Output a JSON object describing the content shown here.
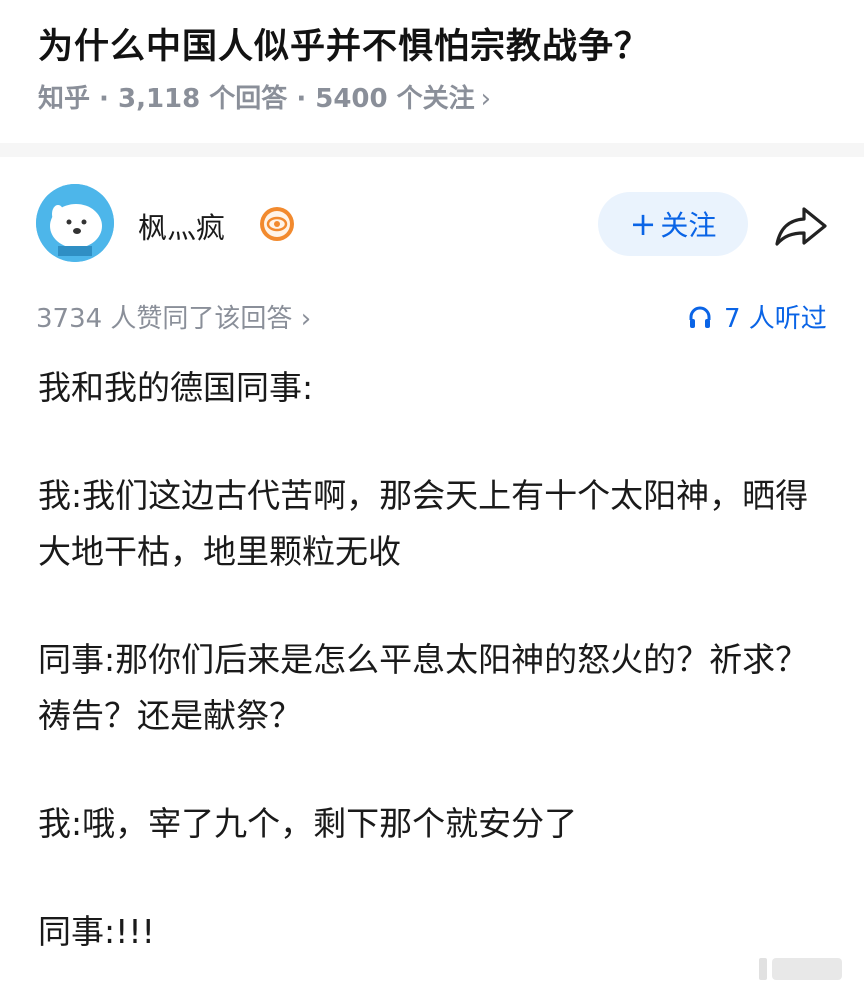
{
  "question": {
    "title": "为什么中国人似乎并不惧怕宗教战争？",
    "meta": "知乎 · 3,118 个回答 · 5400 个关注",
    "meta_chevron": "›"
  },
  "author": {
    "name": "枫灬疯",
    "follow_label": "关注",
    "follow_plus": "+"
  },
  "answer": {
    "upvotes": "3734 人赞同了该回答 ›",
    "listened": "7 人听过",
    "paragraphs": [
      "我和我的德国同事:",
      "我:我们这边古代苦啊，那会天上有十个太阳神，晒得大地干枯，地里颗粒无收",
      "同事:那你们后来是怎么平息太阳神的怒火的？祈求？祷告？还是献祭？",
      "我:哦，宰了九个，剩下那个就安分了",
      "同事:!!!"
    ]
  },
  "colors": {
    "accent": "#0a64e6",
    "follow_bg": "#eaf3fd",
    "meta_gray": "#8a8f99",
    "avatar_bg": "#4db6ea",
    "badge_orange": "#f28a2e"
  },
  "icons": {
    "badge": "eye-badge-icon",
    "share": "share-arrow-icon",
    "listen": "headphones-icon"
  }
}
